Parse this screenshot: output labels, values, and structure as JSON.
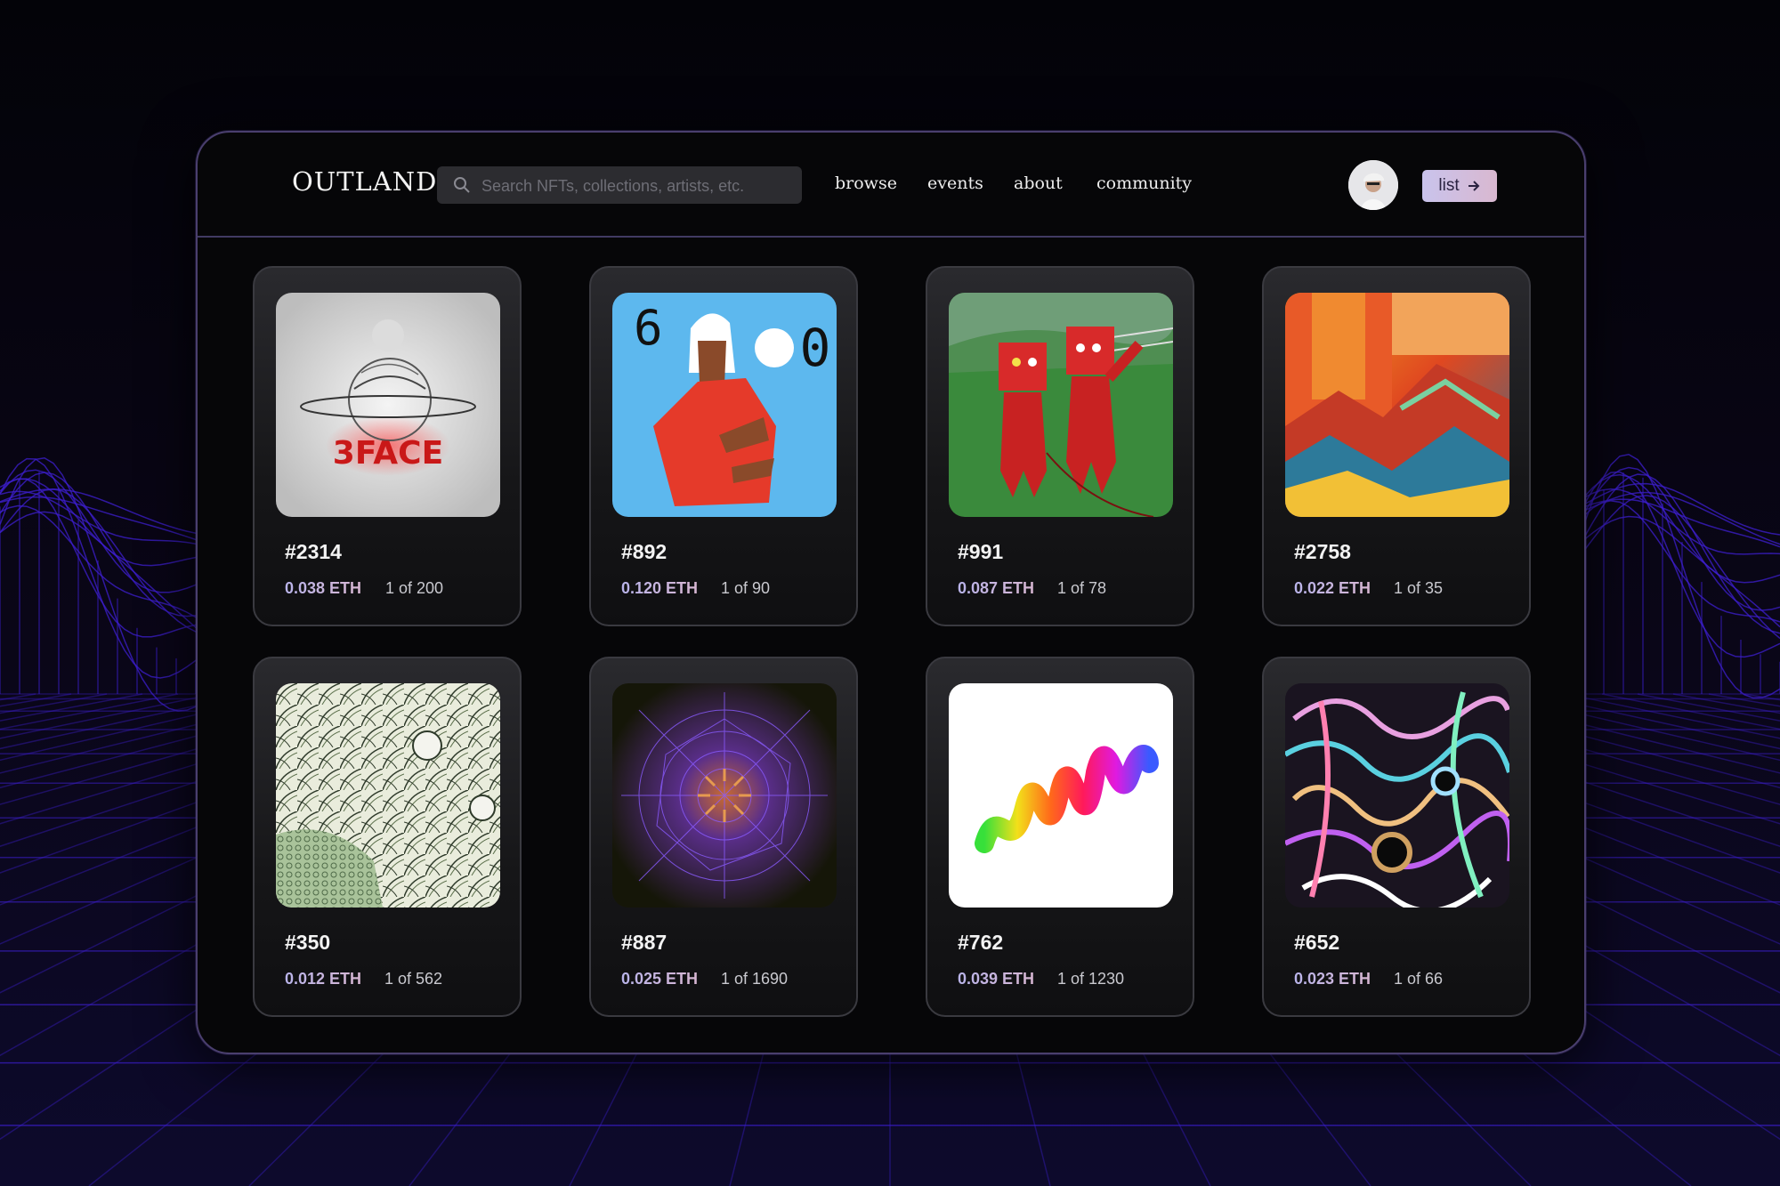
{
  "app": {
    "brand": "OUTLAND"
  },
  "search": {
    "placeholder": "Search NFTs, collections, artists, etc."
  },
  "nav": {
    "links": [
      "browse",
      "events",
      "about",
      "community"
    ]
  },
  "actions": {
    "list_label": "list",
    "list_icon": "arrow-right-icon"
  },
  "user": {
    "avatar": "user-avatar"
  },
  "colors": {
    "accent_start": "#c9c3ec",
    "accent_end": "#d9b8d0",
    "background_wave": "#3d1fd0"
  },
  "nfts": [
    {
      "id": "#2314",
      "price": "0.038 ETH",
      "edition": "1 of 200",
      "art_text": "3FACE"
    },
    {
      "id": "#892",
      "price": "0.120 ETH",
      "edition": "1 of 90",
      "art_text_left": "6",
      "art_text_right": "0"
    },
    {
      "id": "#991",
      "price": "0.087 ETH",
      "edition": "1 of 78"
    },
    {
      "id": "#2758",
      "price": "0.022 ETH",
      "edition": "1 of 35"
    },
    {
      "id": "#350",
      "price": "0.012 ETH",
      "edition": "1 of 562"
    },
    {
      "id": "#887",
      "price": "0.025 ETH",
      "edition": "1 of 1690"
    },
    {
      "id": "#762",
      "price": "0.039 ETH",
      "edition": "1 of 1230"
    },
    {
      "id": "#652",
      "price": "0.023 ETH",
      "edition": "1 of 66"
    }
  ]
}
